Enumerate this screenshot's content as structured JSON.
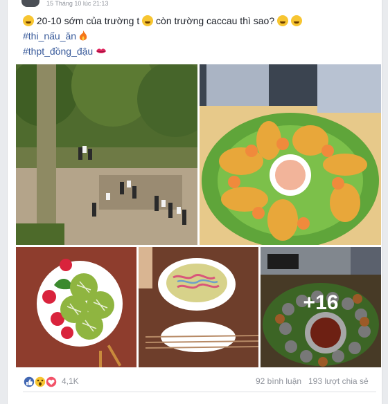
{
  "post": {
    "header_fragment": "15 Tháng 10 lúc 21:13",
    "line1_a": "20-10 sớm của trường t",
    "line1_b": "còn trường caccau thì sao?",
    "line2_tag": "#thi_nấu_ăn",
    "line3_tag": "#thpt_đồng_đậu"
  },
  "photos": {
    "more_count": "+16"
  },
  "footer": {
    "reaction_count": "4,1K",
    "comments": "92 bình luận",
    "shares": "193 lượt chia sẻ"
  },
  "colors": {
    "like_blue": "#4267b2",
    "love_red": "#f25268",
    "haha_yellow": "#f7c531",
    "link_blue": "#365899"
  },
  "icons": [
    "emoji-rofl-icon",
    "emoji-wink-icon",
    "emoji-laugh-icon",
    "fire-icon",
    "kiss-icon",
    "like-reaction-icon",
    "wow-reaction-icon",
    "love-reaction-icon"
  ]
}
